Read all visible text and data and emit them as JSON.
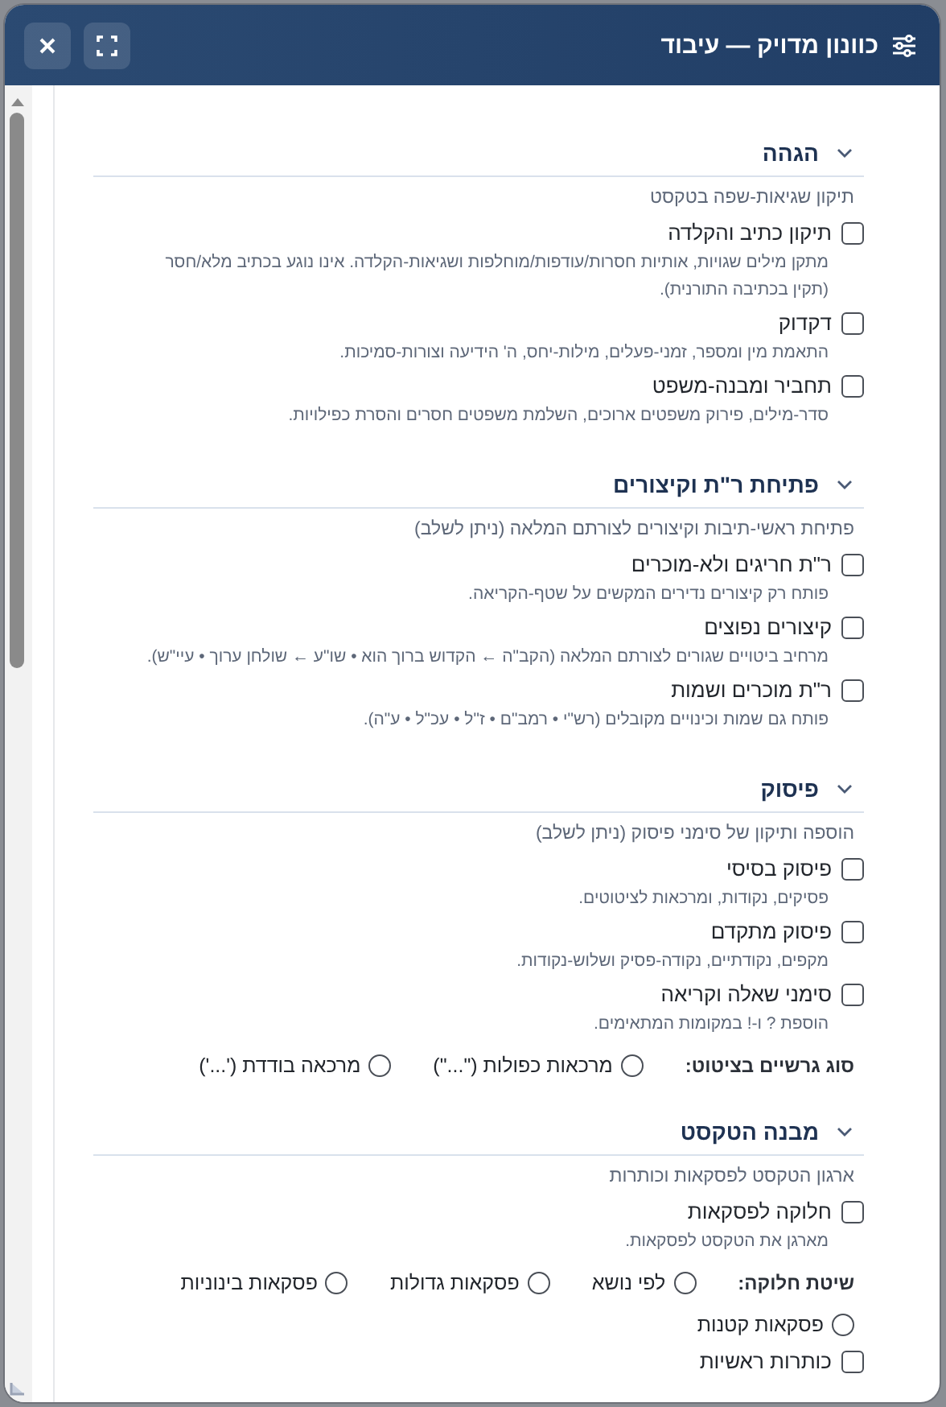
{
  "window": {
    "title": "כוונון מדויק — עיבוד"
  },
  "sections": [
    {
      "title": "הגהה",
      "expanded": true,
      "subtitle": "תיקון שגיאות-שפה בטקסט",
      "items": [
        {
          "kind": "checkbox",
          "label": "תיקון כתיב והקלדה",
          "checked": false,
          "description": "מתקן מילים שגויות, אותיות חסרות/עודפות/מוחלפות ושגיאות-הקלדה. אינו נוגע בכתיב מלא/חסר (תקין בכתיבה התורנית)."
        },
        {
          "kind": "checkbox",
          "label": "דקדוק",
          "checked": false,
          "description": "התאמת מין ומספר, זמני-פעלים, מילות-יחס, ה' הידיעה וצורות-סמיכות."
        },
        {
          "kind": "checkbox",
          "label": "תחביר ומבנה-משפט",
          "checked": false,
          "description": "סדר-מילים, פירוק משפטים ארוכים, השלמת משפטים חסרים והסרת כפילויות."
        }
      ]
    },
    {
      "title": "פתיחת ר\"ת וקיצורים",
      "expanded": true,
      "subtitle": "פתיחת ראשי-תיבות וקיצורים לצורתם המלאה (ניתן לשלב)",
      "items": [
        {
          "kind": "checkbox",
          "label": "ר\"ת חריגים ולא-מוכרים",
          "checked": false,
          "description": "פותח רק קיצורים נדירים המקשים על שטף-הקריאה."
        },
        {
          "kind": "checkbox",
          "label": "קיצורים נפוצים",
          "checked": false,
          "description": "מרחיב ביטויים שגורים לצורתם המלאה (הקב\"ה ← הקדוש ברוך הוא • שו\"ע ← שולחן ערוך • עיי\"ש)."
        },
        {
          "kind": "checkbox",
          "label": "ר\"ת מוכרים ושמות",
          "checked": false,
          "description": "פותח גם שמות וכינויים מקובלים (רש\"י • רמב\"ם • ז\"ל • עכ\"ל • ע\"ה)."
        }
      ]
    },
    {
      "title": "פיסוק",
      "expanded": true,
      "subtitle": "הוספה ותיקון של סימני פיסוק (ניתן לשלב)",
      "items": [
        {
          "kind": "checkbox",
          "label": "פיסוק בסיסי",
          "checked": false,
          "description": "פסיקים, נקודות, ומרכאות לציטוטים."
        },
        {
          "kind": "checkbox",
          "label": "פיסוק מתקדם",
          "checked": false,
          "description": "מקפים, נקודתיים, נקודה-פסיק ושלוש-נקודות."
        },
        {
          "kind": "checkbox",
          "label": "סימני שאלה וקריאה",
          "checked": false,
          "description": "הוספת ? ו-! במקומות המתאימים."
        },
        {
          "kind": "radio",
          "label": "סוג גרשיים בציטוט:",
          "options": [
            {
              "label": "מרכאות כפולות (\"...\")",
              "selected": false
            },
            {
              "label": "מרכאה בודדת ('...')",
              "selected": false
            }
          ]
        }
      ]
    },
    {
      "title": "מבנה הטקסט",
      "expanded": true,
      "subtitle": "ארגון הטקסט לפסקאות וכותרות",
      "items": [
        {
          "kind": "checkbox",
          "label": "חלוקה לפסקאות",
          "checked": false,
          "description": "מארגן את הטקסט לפסקאות."
        },
        {
          "kind": "radio",
          "label": "שיטת חלוקה:",
          "options": [
            {
              "label": "לפי נושא",
              "selected": false
            },
            {
              "label": "פסקאות גדולות",
              "selected": false
            },
            {
              "label": "פסקאות בינוניות",
              "selected": false
            },
            {
              "label": "פסקאות קטנות",
              "selected": false
            }
          ]
        },
        {
          "kind": "checkbox",
          "label": "כותרות ראשיות",
          "checked": false
        }
      ]
    }
  ]
}
